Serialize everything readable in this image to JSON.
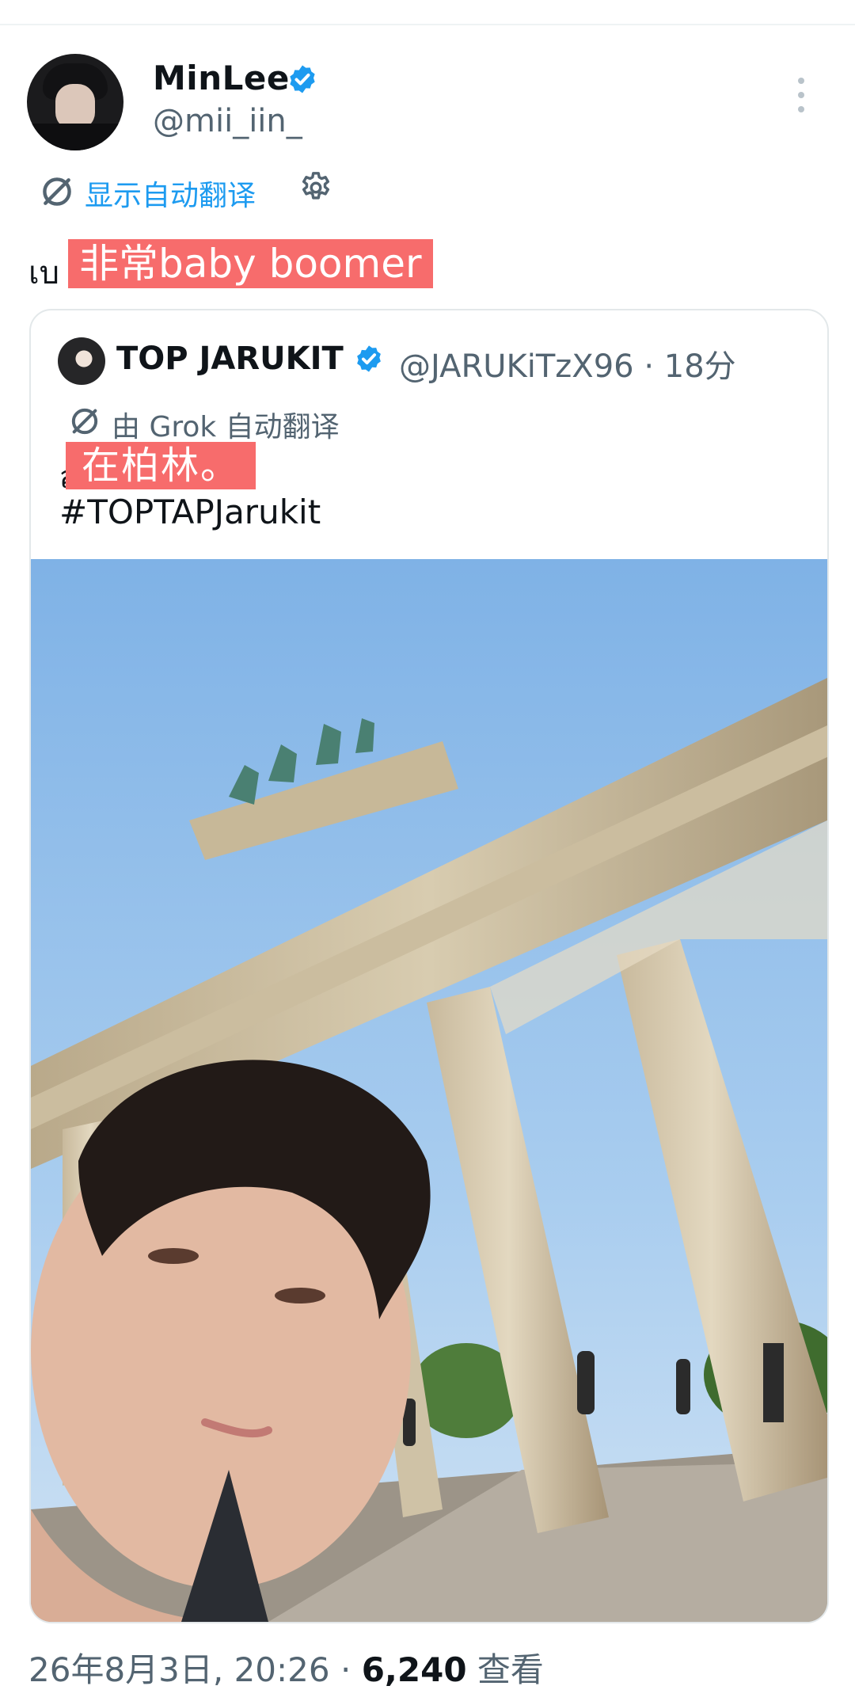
{
  "tweet": {
    "author_name": "MinLee",
    "author_handle": "@mii_iin_",
    "verified": true,
    "translate_label": "显示自动翻译",
    "translate_icon": "translate-icon",
    "settings_icon": "gear-icon",
    "more_icon": "more-vertical-icon",
    "original_prefix": "เบ",
    "translated_text": "非常baby boomer"
  },
  "quoted": {
    "author_name": "TOP JARUKIT",
    "author_handle": "@JARUKiTzX96 · 18分",
    "verified": true,
    "translate_label": "由 Grok 自动翻译",
    "original_stub": "ส",
    "translated_text": "在柏林。",
    "hashtag": "#TOPTAPJarukit",
    "media_description": "selfie-photo"
  },
  "meta": {
    "timestamp": "26年8月3日, 20:26",
    "separator": " · ",
    "views_count": "6,240",
    "views_label": "查看"
  },
  "colors": {
    "accent": "#1d9bf0",
    "highlight": "#f76c6c",
    "secondary_text": "#536471",
    "border": "#e3e8ea"
  }
}
